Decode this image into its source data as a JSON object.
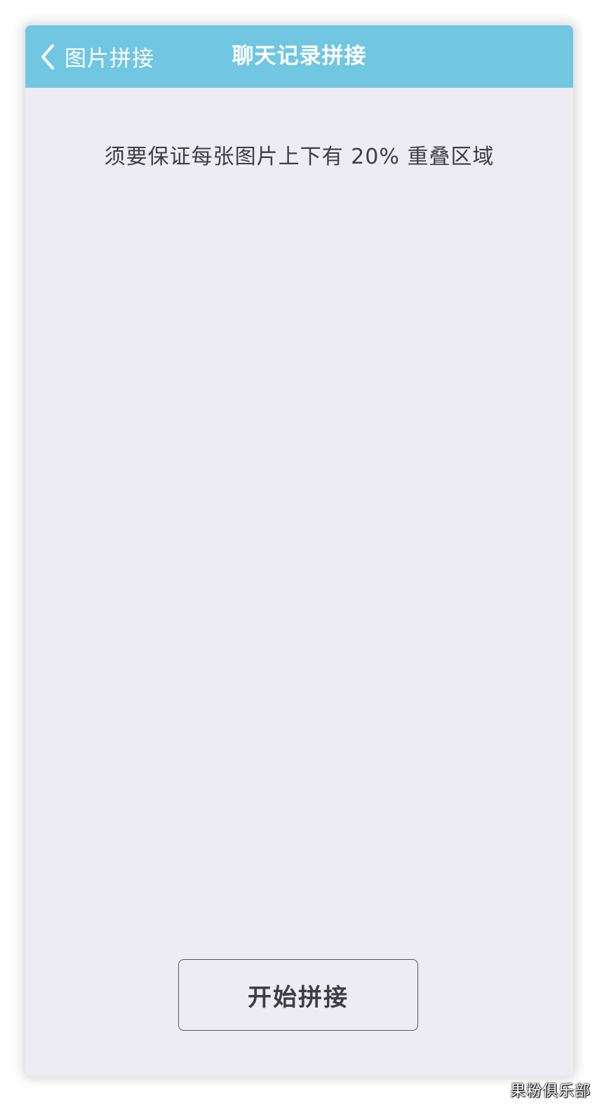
{
  "nav": {
    "back_label": "图片拼接",
    "back_icon": "chevron-left-icon",
    "title": "聊天记录拼接",
    "bar_color": "#71c6e2"
  },
  "main": {
    "hint": "须要保证每张图片上下有 20% 重叠区域",
    "start_button_label": "开始拼接",
    "background_color": "#eeecf3"
  },
  "watermark": "果粉俱乐部"
}
